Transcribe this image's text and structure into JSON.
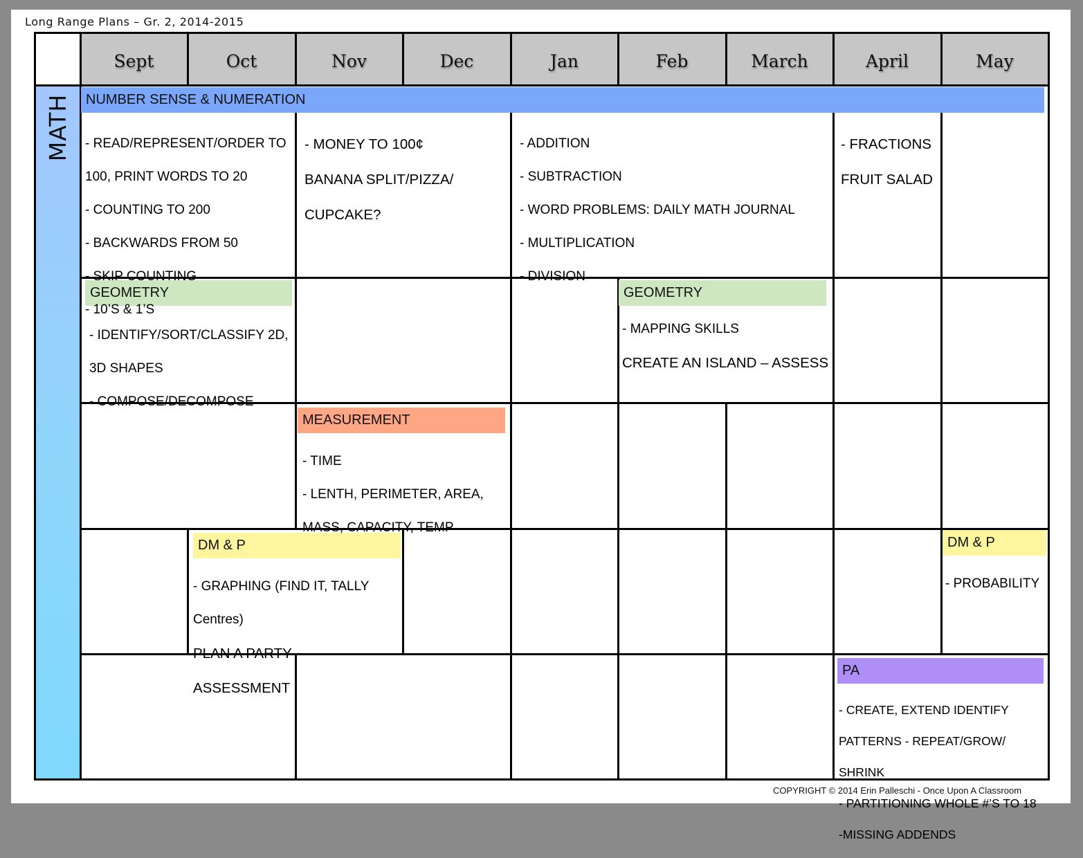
{
  "document": {
    "title": "Long Range Plans – Gr. 2, 2014-2015",
    "copyright": "COPYRIGHT © 2014 Erin Palleschi - Once Upon A Classroom"
  },
  "subject": "MATH",
  "months": [
    "Sept",
    "Oct",
    "Nov",
    "Dec",
    "Jan",
    "Feb",
    "March",
    "April",
    "May"
  ],
  "colors": {
    "number_sense": "#7ba7fb",
    "geometry": "#cfe7c1",
    "measurement": "#ffa784",
    "data_management": "#fef69e",
    "patterning": "#b08ef8",
    "month_header": "#c6c6c6"
  },
  "bands": {
    "number_sense": "NUMBER SENSE & NUMERATION",
    "geometry_fall": "GEOMETRY",
    "geometry_winter": "GEOMETRY",
    "measurement": "MEASUREMENT",
    "dmp_fall": "DM & P",
    "dmp_spring": "DM & P",
    "pa": "PA"
  },
  "cells": {
    "ns_sept_oct": [
      "- READ/REPRESENT/ORDER TO",
      "100, PRINT WORDS TO 20",
      "- COUNTING TO 200",
      "- BACKWARDS FROM 50",
      "- SKIP COUNTING",
      "- 10’S & 1’S"
    ],
    "ns_nov_dec": [
      "- MONEY TO 100¢",
      "BANANA SPLIT/PIZZA/",
      "CUPCAKE?"
    ],
    "ns_jan_march": [
      "- ADDITION",
      "- SUBTRACTION",
      "- WORD PROBLEMS: DAILY MATH JOURNAL",
      "- MULTIPLICATION",
      "- DIVISION"
    ],
    "ns_april": [
      "- FRACTIONS",
      "FRUIT SALAD"
    ],
    "geo_sept_oct": [
      "- IDENTIFY/SORT/CLASSIFY 2D,",
      "3D SHAPES",
      "- COMPOSE/DECOMPOSE"
    ],
    "geo_feb_march_line1": "- MAPPING SKILLS",
    "geo_feb_march_line2": "CREATE AN ISLAND – ASSESS",
    "meas_nov_dec": [
      "- TIME",
      "- LENTH, PERIMETER, AREA,",
      "MASS, CAPACITY, TEMP"
    ],
    "dmp_oct_nov_small": [
      "- GRAPHING (FIND IT, TALLY",
      "Centres)"
    ],
    "dmp_oct_nov_big": [
      "PLAN A PARTY –",
      "ASSESSMENT"
    ],
    "dmp_may": [
      "- PROBABILITY"
    ],
    "pa_april_may": [
      "- CREATE, EXTEND IDENTIFY",
      "PATTERNS - REPEAT/GROW/",
      "SHRINK",
      "- PARTITIONING WHOLE #’S TO 18",
      "-MISSING ADDENDS"
    ]
  }
}
